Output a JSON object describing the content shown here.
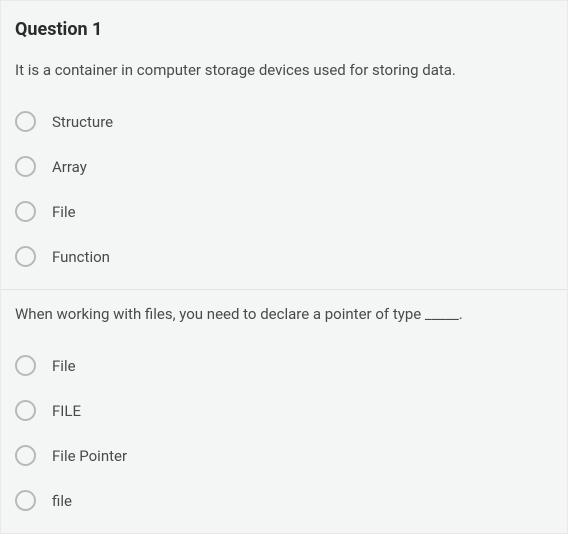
{
  "question": {
    "title": "Question 1",
    "prompts": [
      "It is a container in computer storage devices used for storing data.",
      "When working with files, you need to declare a pointer of type _____."
    ],
    "group1": [
      "Structure",
      "Array",
      "File",
      "Function"
    ],
    "group2": [
      "File",
      "FILE",
      "File Pointer",
      "file"
    ]
  }
}
